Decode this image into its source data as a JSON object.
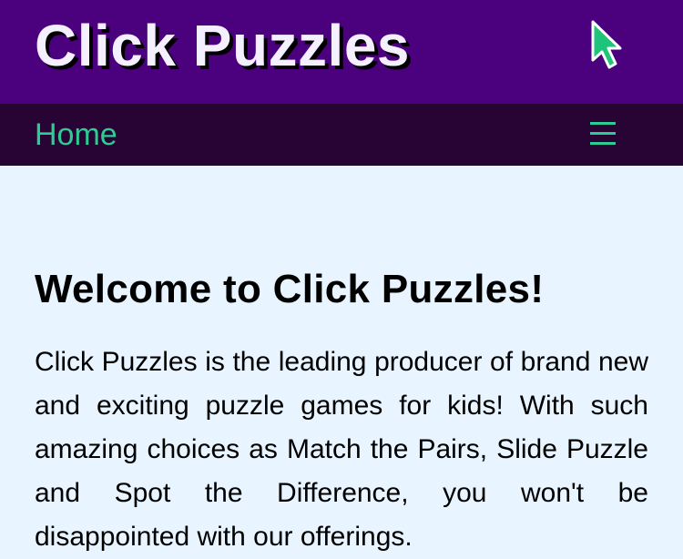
{
  "header": {
    "title": "Click Puzzles",
    "background": "#4b007d",
    "cursor_icon": "mouse-pointer-icon"
  },
  "nav": {
    "home_label": "Home",
    "menu_icon": "hamburger-menu-icon",
    "background": "#280434",
    "accent": "#2ecc95"
  },
  "main": {
    "heading": "Welcome to Click Puzzles!",
    "intro": "Click Puzzles is the leading producer of brand new and exciting puzzle games for kids! With such amazing choices as Match the Pairs, Slide Puzzle and Spot the Difference, you won't be disappointed with our offerings.",
    "background": "#e8f4ff"
  }
}
